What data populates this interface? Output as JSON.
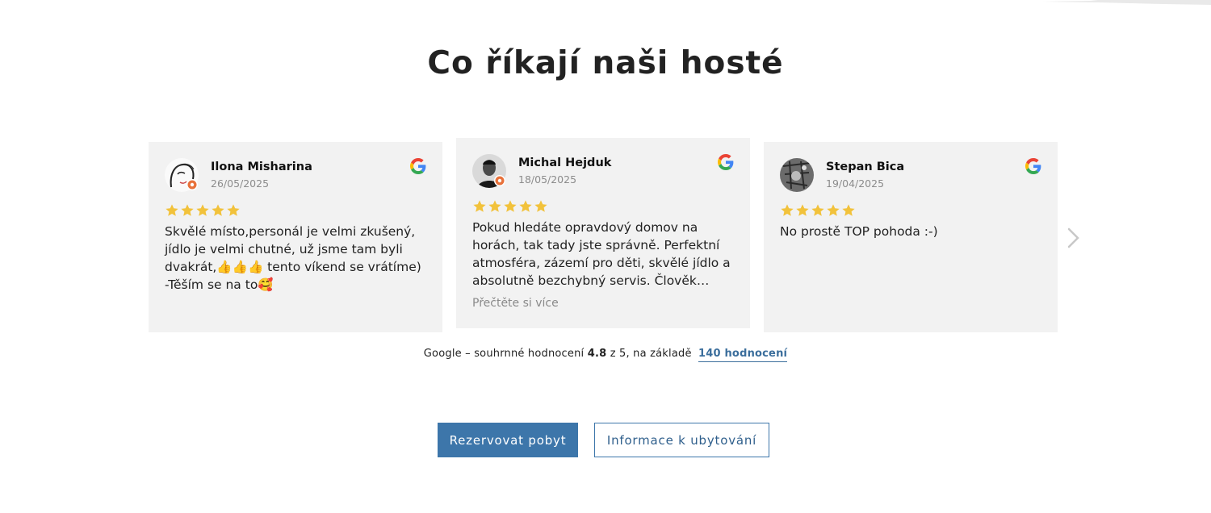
{
  "section": {
    "title": "Co říkají naši hosté"
  },
  "reviews": [
    {
      "name": "Ilona Misharina",
      "date": "26/05/2025",
      "rating": 5,
      "text": "Skvělé místo,personál je velmi zkušený, jídlo je velmi chutné, už jsme tam byli dvakrát,👍👍👍 tento víkend se vrátíme) -Těším se na to🥰",
      "source_icon": "google-icon",
      "avatar_icon": "avatar-sketch"
    },
    {
      "name": "Michal Hejduk",
      "date": "18/05/2025",
      "rating": 5,
      "text": "Pokud hledáte opravdový domov na horách, tak tady jste správně. Perfektní atmosféra, zázemí pro děti, skvělé jídlo a absolutně bezchybný servis. Člověk nerad odjíždí. Mo...",
      "read_more": "Přečtěte si více",
      "source_icon": "google-icon",
      "avatar_icon": "avatar-photo"
    },
    {
      "name": "Stepan Bica",
      "date": "19/04/2025",
      "rating": 5,
      "text": "No prostě TOP pohoda :-)",
      "source_icon": "google-icon",
      "avatar_icon": "avatar-photo"
    }
  ],
  "summary": {
    "prefix": "Google – souhrnné hodnocení",
    "score": "4.8",
    "middle": "z 5, na základě",
    "link": "140 hodnocení"
  },
  "buttons": {
    "primary": "Rezervovat pobyt",
    "secondary": "Informace k ubytování"
  },
  "colors": {
    "star": "#f2c23b",
    "accent": "#3d76aa",
    "card_bg": "#f2f2f2"
  }
}
